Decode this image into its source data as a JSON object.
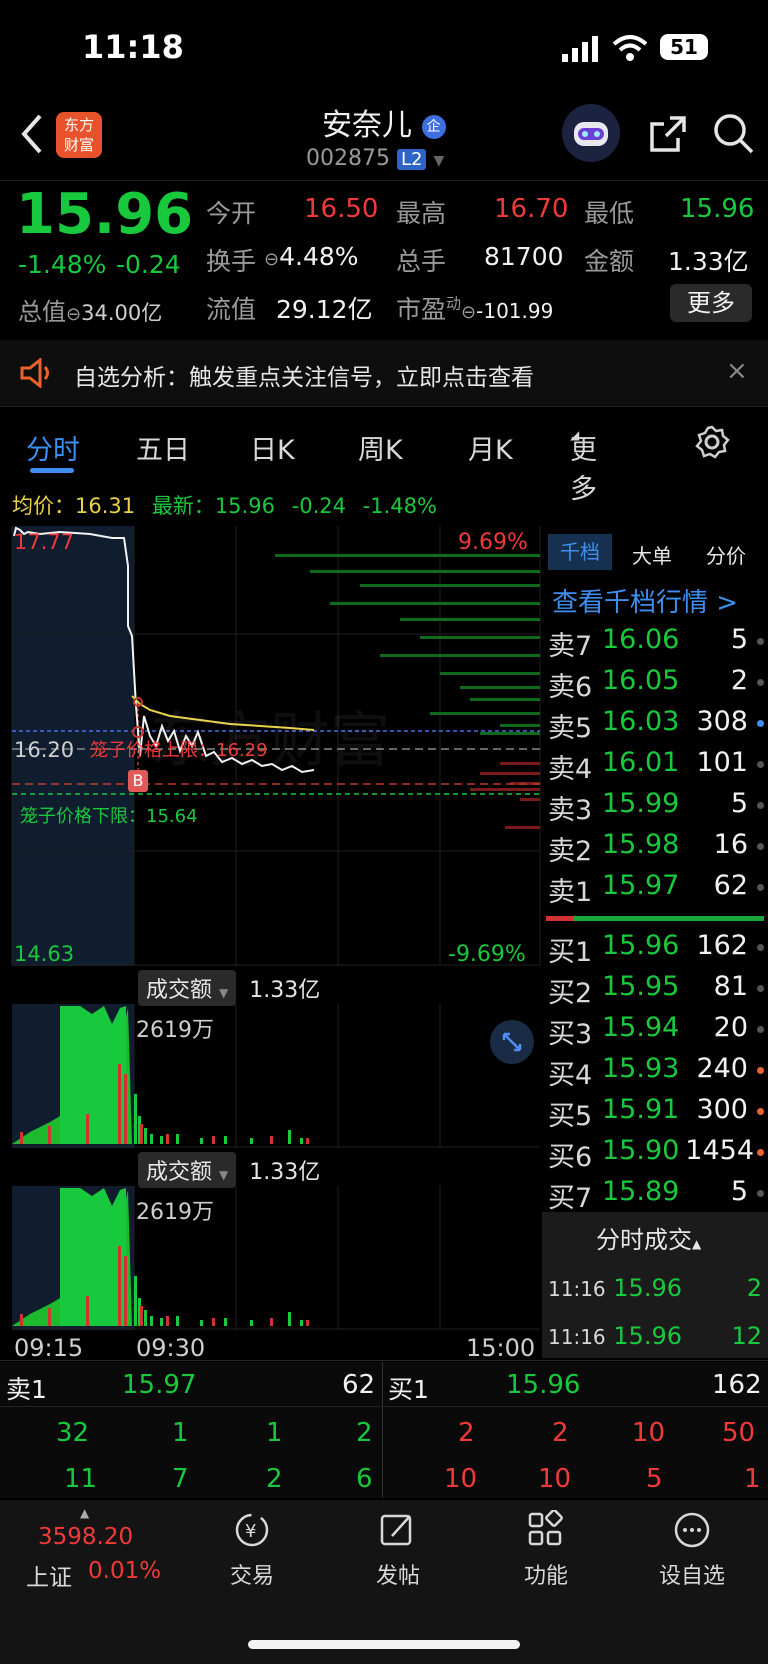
{
  "status_bar": {
    "time": "11:18",
    "battery": "51"
  },
  "header": {
    "stock_name": "安奈儿",
    "badge": "企",
    "code": "002875",
    "level": "L2",
    "logo_line1": "东方",
    "logo_line2": "财富"
  },
  "quote": {
    "price": "15.96",
    "pct": "-1.48%",
    "change": "-0.24",
    "open_label": "今开",
    "open": "16.50",
    "high_label": "最高",
    "high": "16.70",
    "low_label": "最低",
    "low": "15.96",
    "turnover_label": "换手",
    "turnover": "4.48%",
    "volume_label": "总手",
    "volume": "81700",
    "amount_label": "金额",
    "amount": "1.33亿",
    "mktcap_label": "总值",
    "mktcap": "34.00亿",
    "float_label": "流值",
    "float": "29.12亿",
    "pe_label": "市盈",
    "pe_sup": "动",
    "pe": "-101.99",
    "more_button": "更多"
  },
  "notice": {
    "text": "自选分析：触发重点关注信号，立即点击查看"
  },
  "tabs": [
    "分时",
    "五日",
    "日K",
    "周K",
    "月K",
    "更多"
  ],
  "intraday": {
    "avg_label": "均价：",
    "avg": "16.31",
    "latest_label": "最新：",
    "latest": "15.96",
    "change": "-0.24",
    "pct": "-1.48%",
    "top_price": "17.77",
    "top_pct": "9.69%",
    "mid_price": "16.20",
    "bottom_price": "14.63",
    "bottom_pct": "-9.69%",
    "upper_band_label": "笼子价格上限：16.29",
    "lower_band_label": "笼子价格下限：15.64",
    "marker": "B",
    "amount_label": "成交额",
    "amount_total": "1.33亿",
    "amount_max": "2619万",
    "time_start": "09:15",
    "time_mid": "09:30",
    "time_end": "15:00"
  },
  "orderbook": {
    "tabs": [
      "千档",
      "大单",
      "分价"
    ],
    "link": "查看千档行情 >",
    "asks": [
      {
        "label": "卖7",
        "price": "16.06",
        "vol": "5"
      },
      {
        "label": "卖6",
        "price": "16.05",
        "vol": "2"
      },
      {
        "label": "卖5",
        "price": "16.03",
        "vol": "308"
      },
      {
        "label": "卖4",
        "price": "16.01",
        "vol": "101"
      },
      {
        "label": "卖3",
        "price": "15.99",
        "vol": "5"
      },
      {
        "label": "卖2",
        "price": "15.98",
        "vol": "16"
      },
      {
        "label": "卖1",
        "price": "15.97",
        "vol": "62"
      }
    ],
    "bids": [
      {
        "label": "买1",
        "price": "15.96",
        "vol": "162"
      },
      {
        "label": "买2",
        "price": "15.95",
        "vol": "81"
      },
      {
        "label": "买3",
        "price": "15.94",
        "vol": "20"
      },
      {
        "label": "买4",
        "price": "15.93",
        "vol": "240"
      },
      {
        "label": "买5",
        "price": "15.91",
        "vol": "300"
      },
      {
        "label": "买6",
        "price": "15.90",
        "vol": "1454"
      },
      {
        "label": "买7",
        "price": "15.89",
        "vol": "5"
      }
    ],
    "trades_title": "分时成交",
    "trades": [
      {
        "time": "11:16",
        "price": "15.96",
        "vol": "2"
      },
      {
        "time": "11:16",
        "price": "15.96",
        "vol": "12"
      }
    ]
  },
  "level1": {
    "sell_label": "卖1",
    "sell_price": "15.97",
    "sell_vol": "62",
    "buy_label": "买1",
    "buy_price": "15.96",
    "buy_vol": "162",
    "sell_queue": [
      [
        "32",
        "1",
        "1",
        "2"
      ],
      [
        "11",
        "7",
        "2",
        "6"
      ]
    ],
    "buy_queue": [
      [
        "2",
        "2",
        "10",
        "50"
      ],
      [
        "10",
        "10",
        "5",
        "1"
      ]
    ]
  },
  "bottom_nav": {
    "index_value": "3598.20",
    "index_name": "上证",
    "index_pct": "0.01%",
    "items": [
      "交易",
      "发帖",
      "功能",
      "设自选"
    ]
  },
  "colors": {
    "up": "#f03a3a",
    "down": "#18c93e",
    "accent": "#3d8ff2",
    "avg_line": "#e8d24a"
  }
}
